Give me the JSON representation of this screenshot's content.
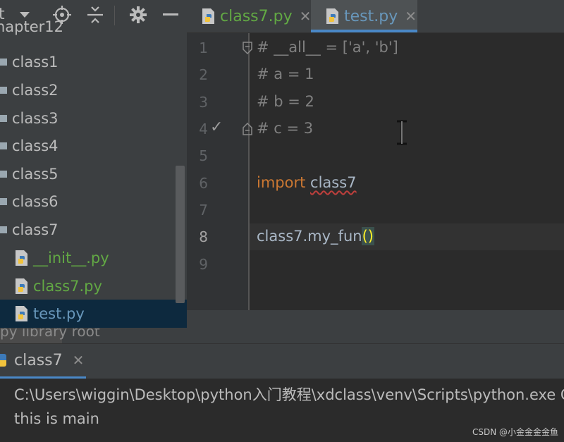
{
  "project_toolbar": {
    "title_fragment": "t",
    "dropdown_icon": "caret-down-icon",
    "icons": [
      "crosshair-icon",
      "collapse-all-icon",
      "gear-icon",
      "minimize-icon"
    ]
  },
  "tree": {
    "partial_top": "hapter12",
    "packages": [
      "class1",
      "class2",
      "class3",
      "class4",
      "class5",
      "class6",
      "class7"
    ],
    "files": [
      {
        "name": "__init__.py",
        "color": "#62a844"
      },
      {
        "name": "class7.py",
        "color": "#62a844"
      },
      {
        "name": "test.py",
        "color": "#6897bb",
        "selected": true
      }
    ],
    "partial_bottom": "py  library root"
  },
  "tabs": [
    {
      "label": "class7.py",
      "close": "✕",
      "active": false
    },
    {
      "label": "test.py",
      "close": "✕",
      "active": true
    }
  ],
  "editor": {
    "line_numbers": [
      "1",
      "2",
      "3",
      "4",
      "5",
      "6",
      "7",
      "8",
      "9"
    ],
    "current_line": "8",
    "check_mark": "✓",
    "lines": {
      "l1": "# __all__ = ['a', 'b']",
      "l2": "# a = 1",
      "l3": "# b = 2",
      "l4": "# c = 3",
      "l6_kw": "import",
      "l6_mod": "class7",
      "l8_call": "class7.my_fun",
      "l8_open": "(",
      "l8_close": ")"
    }
  },
  "run": {
    "tab_label": "class7",
    "tab_close": "✕",
    "output": [
      "C:\\Users\\wiggin\\Desktop\\python入门教程\\xdclass\\venv\\Scripts\\python.exe C:",
      "this is main"
    ]
  },
  "watermark": "CSDN @小金金金金鱼",
  "colors": {
    "accent": "#4a88c7",
    "keyword": "#cc7832",
    "comment": "#808080",
    "file_green": "#62a844",
    "file_blue": "#6897bb"
  }
}
